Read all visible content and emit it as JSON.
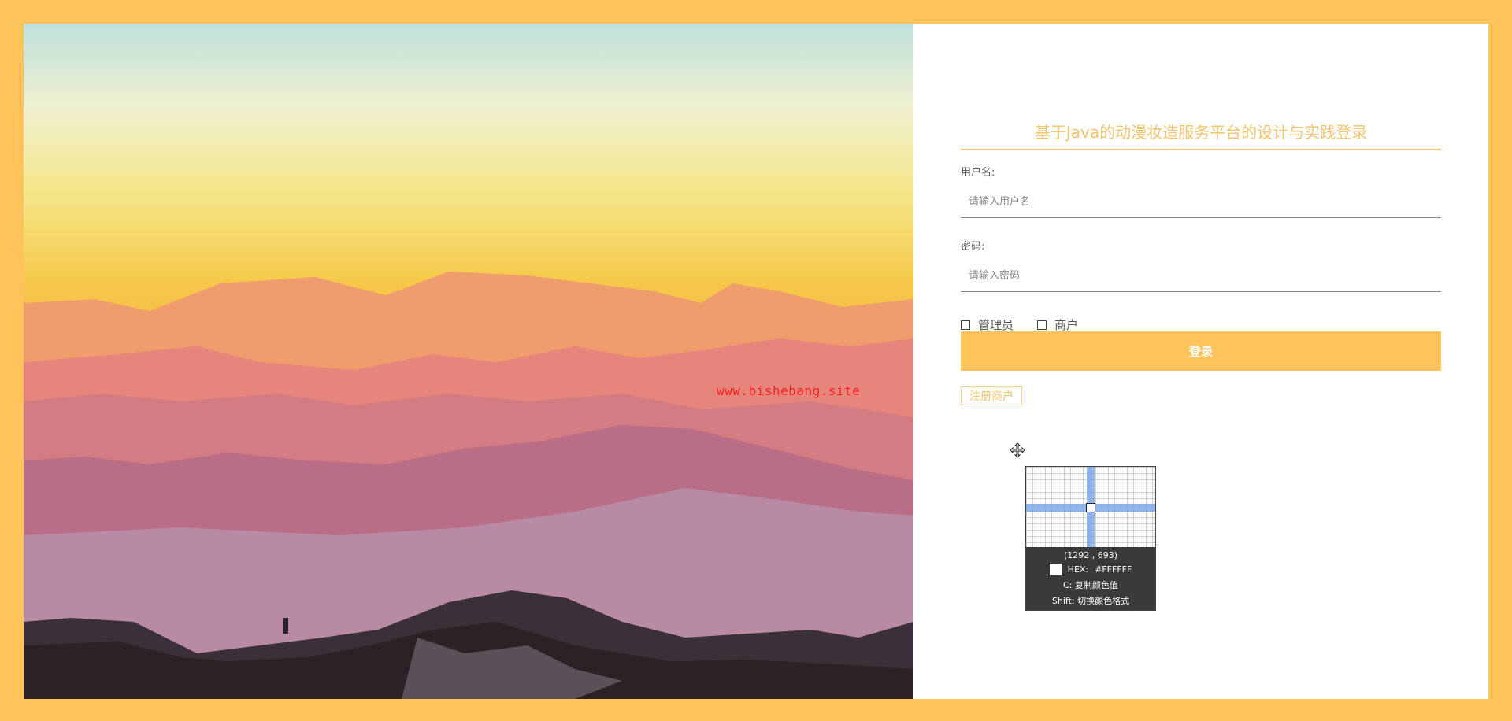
{
  "watermark": "www.bishebang.site",
  "login": {
    "title": "基于Java的动漫妆造服务平台的设计与实践登录",
    "username_label": "用户名:",
    "username_placeholder": "请输入用户名",
    "password_label": "密码:",
    "password_placeholder": "请输入密码",
    "roles": [
      "管理员",
      "商户"
    ],
    "login_button": "登录",
    "register_button": "注册商户"
  },
  "color_picker": {
    "coords": "(1292 ,  693)",
    "hex_label": "HEX:",
    "hex_value": "#FFFFFF",
    "copy_hint": "C: 复制颜色值",
    "shift_hint": "Shift: 切换颜色格式"
  },
  "icons": [
    "move-cursor-icon",
    "checkbox-icon"
  ],
  "colors": {
    "frame": "#ffc35c",
    "accent": "#f4c46e",
    "button": "#ffc35c",
    "watermark": "#ff2020"
  }
}
